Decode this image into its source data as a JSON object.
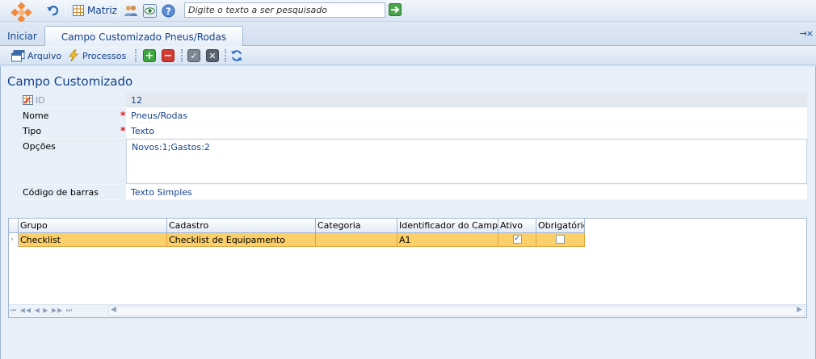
{
  "topbar": {
    "matriz_label": "Matriz",
    "search_placeholder": "Digite o texto a ser pesquisado",
    "search_value": ""
  },
  "tabs": {
    "home_label": "Iniciar",
    "active_label": "Campo Customizado Pneus/Rodas",
    "pin_symbol": "→×"
  },
  "toolbar": {
    "arquivo_label": "Arquivo",
    "processos_label": "Processos"
  },
  "page": {
    "title": "Campo Customizado"
  },
  "form": {
    "id_label": "ID",
    "id_value": "12",
    "nome_label": "Nome",
    "nome_value": "Pneus/Rodas",
    "tipo_label": "Tipo",
    "tipo_value": "Texto",
    "opcoes_label": "Opções",
    "opcoes_value": "Novos:1;Gastos:2",
    "codigo_label": "Código de barras",
    "codigo_value": "Texto Simples",
    "required_mark": "*"
  },
  "grid": {
    "columns": [
      "Grupo",
      "Cadastro",
      "Categoria",
      "Identificador do Campo",
      "Ativo",
      "Obrigatório"
    ],
    "rows": [
      {
        "grupo": "Checklist",
        "cadastro": "Checklist de Equipamento",
        "categoria": "",
        "identificador": "A1",
        "ativo": true,
        "obrigatorio": false
      }
    ],
    "checked_symbol": "✓",
    "nav_symbols": "⏮ ◀◀ ◀ ▶ ▶▶ ⏭",
    "scroll_left": "◀",
    "scroll_right": "▶"
  },
  "colors": {
    "accent": "#15428b",
    "selected_row": "#fbcf6a",
    "background": "#e7eff9"
  }
}
